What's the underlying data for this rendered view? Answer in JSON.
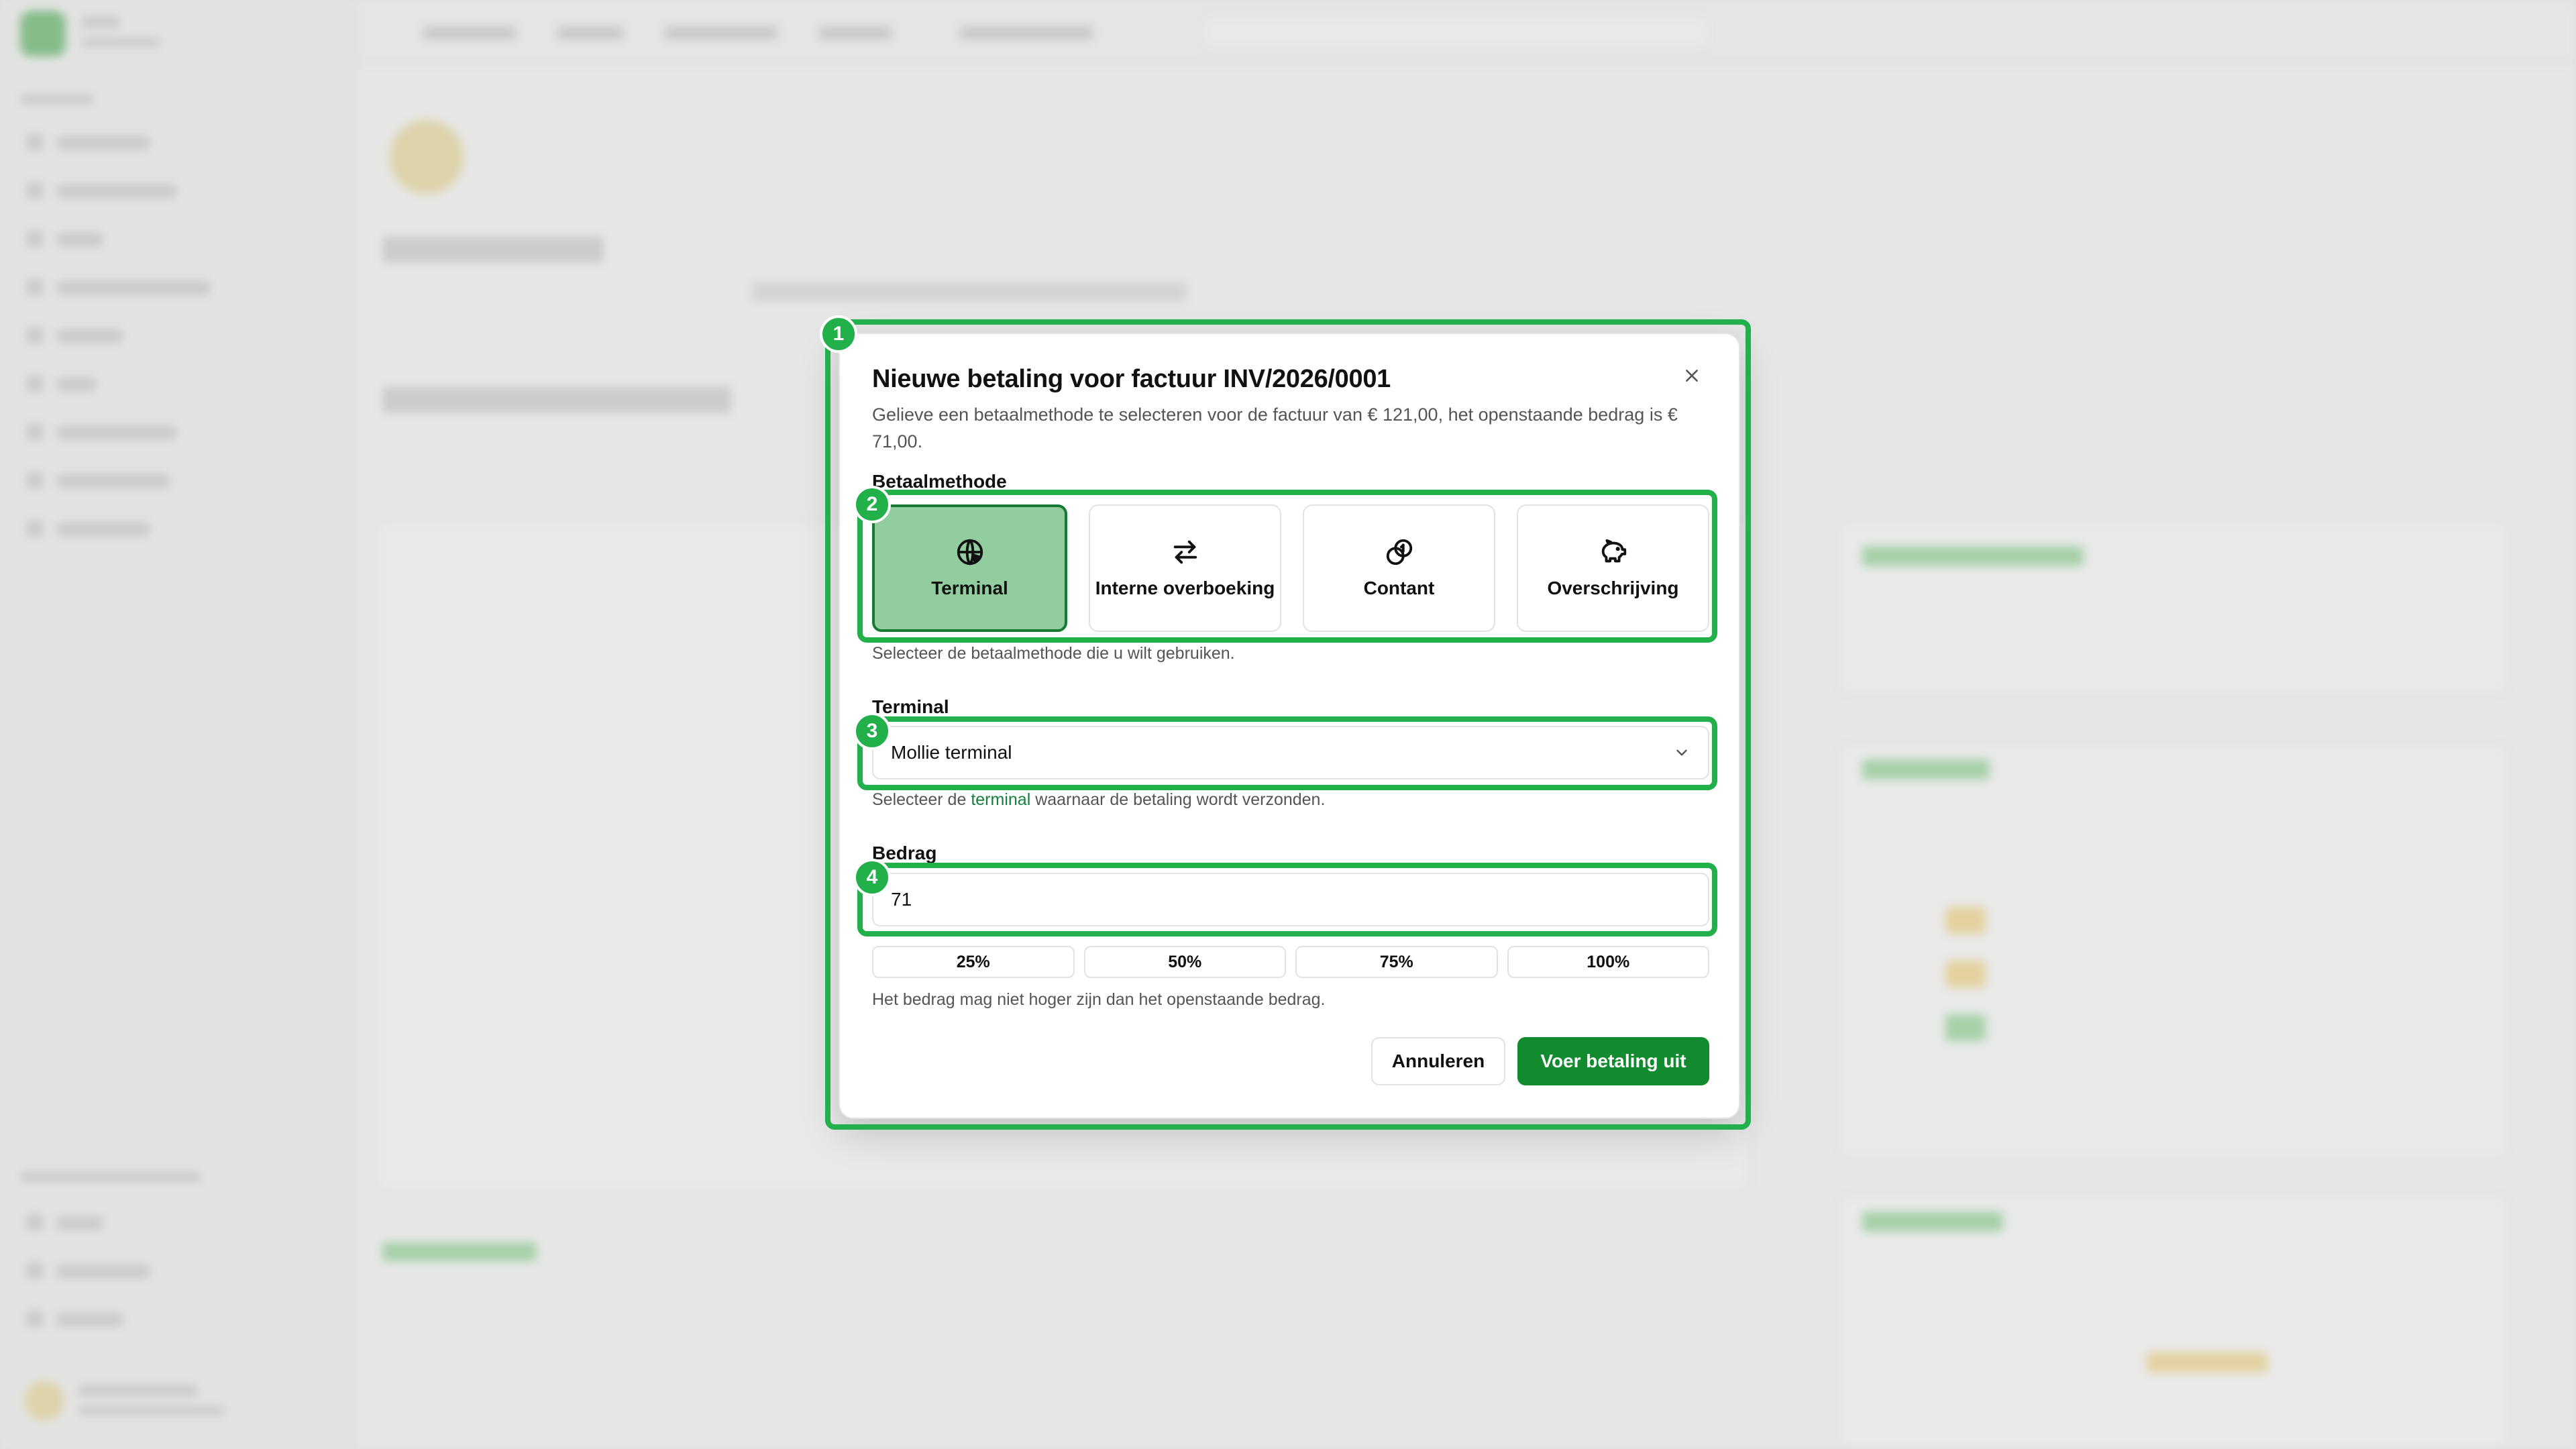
{
  "dialog": {
    "title": "Nieuwe betaling voor factuur INV/2026/0001",
    "description": "Gelieve een betaalmethode te selecteren voor de factuur van € 121,00, het openstaande bedrag is € 71,00.",
    "method_label": "Betaalmethode",
    "method_help": "Selecteer de betaalmethode die u wilt gebruiken.",
    "methods": [
      {
        "label": "Terminal",
        "icon": "globe-pointer-icon",
        "selected": true
      },
      {
        "label": "Interne overboeking",
        "icon": "arrows-left-right-icon",
        "selected": false
      },
      {
        "label": "Contant",
        "icon": "coins-icon",
        "selected": false
      },
      {
        "label": "Overschrijving",
        "icon": "piggy-bank-icon",
        "selected": false
      }
    ],
    "terminal_label": "Terminal",
    "terminal_value": "Mollie terminal",
    "terminal_help_before": "Selecteer de ",
    "terminal_help_link": "terminal",
    "terminal_help_after": " waarnaar de betaling wordt verzonden.",
    "amount_label": "Bedrag",
    "amount_value": "71",
    "percent_options": [
      "25%",
      "50%",
      "75%",
      "100%"
    ],
    "amount_help": "Het bedrag mag niet hoger zijn dan het openstaande bedrag.",
    "cancel_label": "Annuleren",
    "submit_label": "Voer betaling uit"
  },
  "annotations": [
    "1",
    "2",
    "3",
    "4"
  ],
  "colors": {
    "accent": "#22b04a",
    "primary_button": "#128a2e",
    "selected_card": "#92cda0",
    "link": "#15803d"
  }
}
